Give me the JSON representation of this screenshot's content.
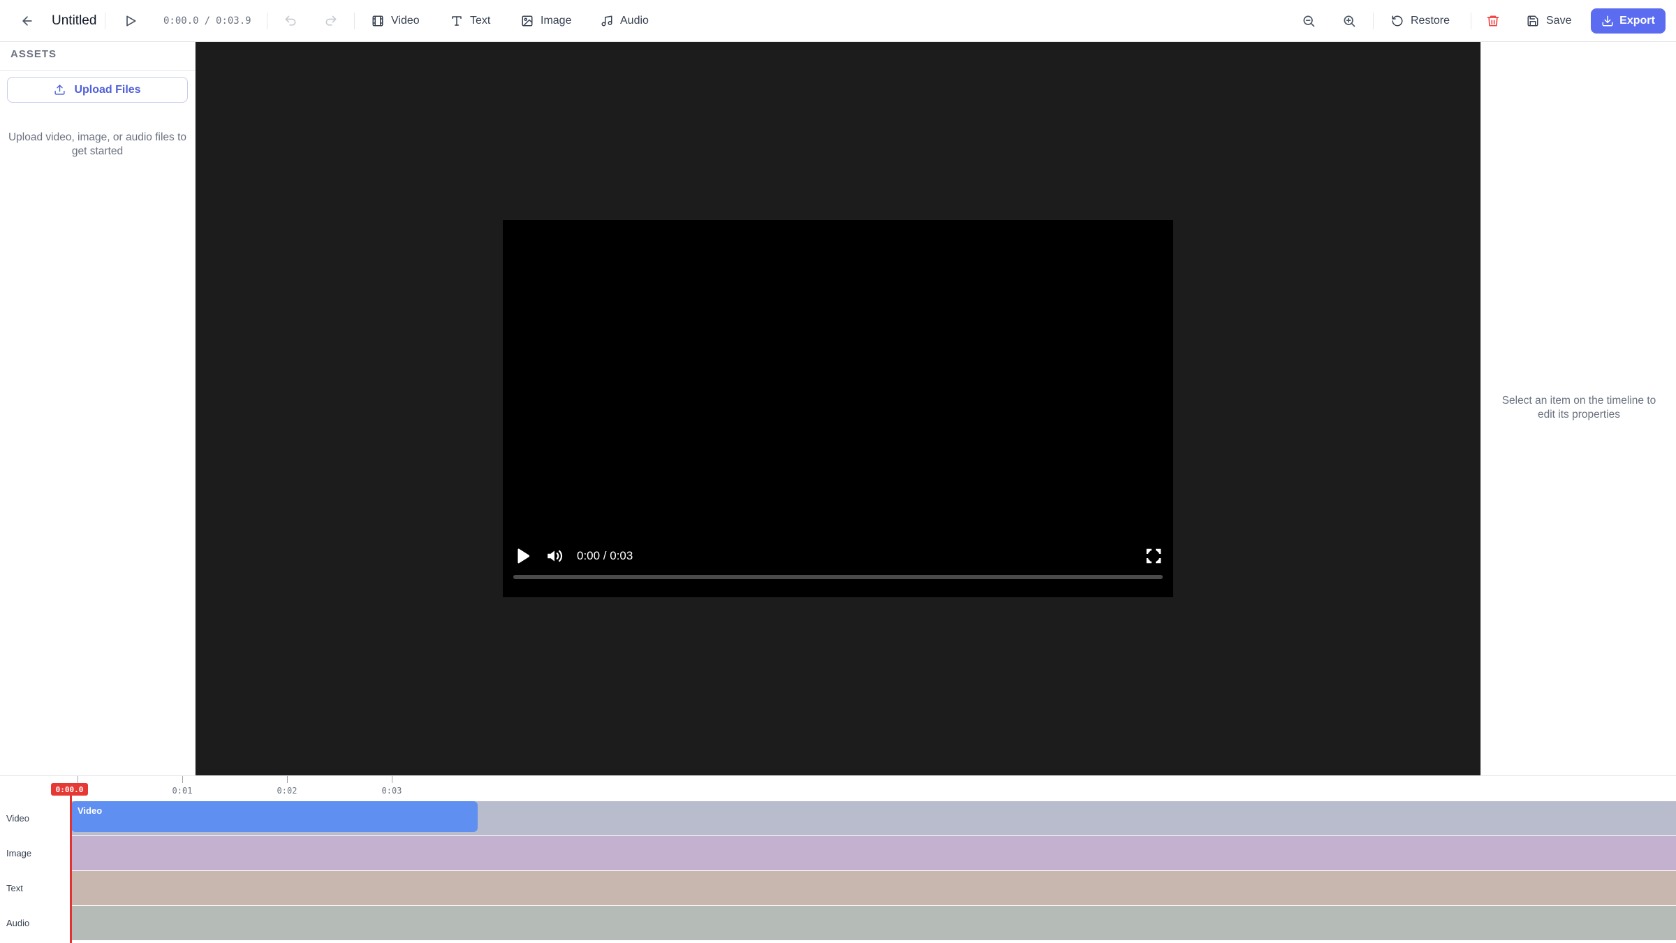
{
  "header": {
    "project_title": "Untitled",
    "time_current": "0:00.0",
    "time_separator": "/",
    "time_total": "0:03.9",
    "tools": {
      "video": "Video",
      "text": "Text",
      "image": "Image",
      "audio": "Audio"
    },
    "restore_label": "Restore",
    "save_label": "Save",
    "export_label": "Export",
    "accent_color": "#5b6cf0",
    "icons": [
      "back-arrow-icon",
      "play-icon",
      "undo-icon",
      "redo-icon",
      "film-icon",
      "text-icon",
      "image-icon",
      "music-icon",
      "zoom-out-icon",
      "zoom-in-icon",
      "restore-icon",
      "trash-icon",
      "save-icon",
      "download-icon"
    ]
  },
  "assets": {
    "heading": "ASSETS",
    "upload_label": "Upload Files",
    "hint": "Upload video, image, or audio files to get started"
  },
  "player": {
    "time": "0:00 / 0:03",
    "progress": 0
  },
  "properties": {
    "hint": "Select an item on the timeline to edit its properties"
  },
  "timeline": {
    "ruler_ticks": [
      "0:01",
      "0:02",
      "0:03"
    ],
    "playhead_time": "0:00.0",
    "tracks": [
      {
        "label": "Video",
        "color": "#b8bccc",
        "clip": "Video"
      },
      {
        "label": "Image",
        "color": "#c3b1cf"
      },
      {
        "label": "Text",
        "color": "#c7b7ae"
      },
      {
        "label": "Audio",
        "color": "#b5bcb8"
      }
    ],
    "clip_color": "#5f8ff0",
    "playhead_color": "#e53935"
  }
}
